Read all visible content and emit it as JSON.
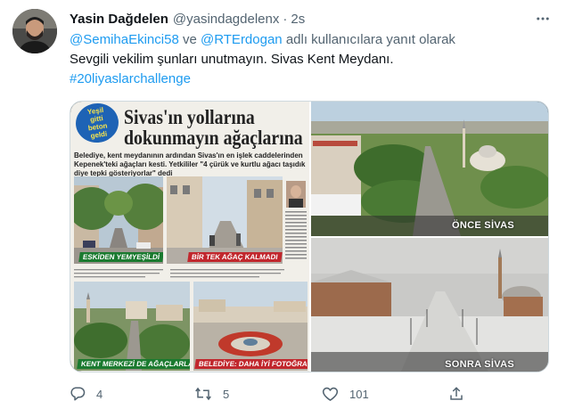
{
  "tweet": {
    "display_name": "Yasin Dağdelen",
    "handle": "@yasindagdelenx",
    "separator": "·",
    "time": "2s",
    "reply": {
      "mention_1": "@SemihaEkinci58",
      "connector": "ve",
      "mention_2": "@RTErdogan",
      "suffix": "adlı kullanıcılara yanıt olarak"
    },
    "text": "Sevgili vekilim şunları unutmayın. Sivas Kent Meydanı.",
    "hashtag": "#20liyaslarchallenge"
  },
  "media": {
    "newspaper": {
      "badge": [
        "Yeşil",
        "gitti",
        "beton",
        "geldi"
      ],
      "headline_1": "Sivas'ın yollarına",
      "headline_2": "dokunmayın ağaçlarına",
      "lead": "Belediye, kent meydanının ardından Sivas'ın en işlek caddelerinden Kepenek'teki ağaçları kesti. Yetkililer \"4 çürük ve kurtlu ağacı taşıdık diye tepki gösteriyorlar\" dedi",
      "caption_1": "ESKİDEN YEMYEŞİLDİ",
      "caption_2": "BİR TEK AĞAÇ KALMADI",
      "caption_3": "KENT MERKEZİ DE AĞAÇLARLA DOLUYDU",
      "caption_4": "BELEDİYE: DAHA İYİ FOTOĞRAF ÇEKİLİYOR"
    },
    "before_label": "ÖNCE SİVAS",
    "after_label": "SONRA SİVAS"
  },
  "actions": {
    "reply_count": "4",
    "retweet_count": "5",
    "like_count": "101"
  }
}
